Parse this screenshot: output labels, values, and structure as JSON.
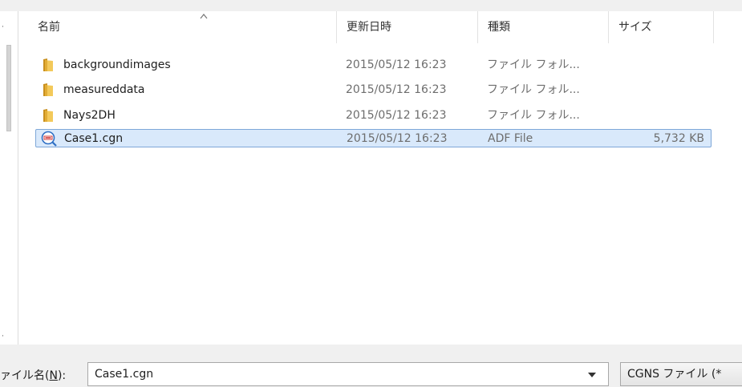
{
  "columns": {
    "name": "名前",
    "date": "更新日時",
    "type": "種類",
    "size": "サイズ"
  },
  "files": [
    {
      "name": "backgroundimages",
      "date": "2015/05/12 16:23",
      "type": "ファイル フォル...",
      "size": "",
      "icon": "folder-icon"
    },
    {
      "name": "measureddata",
      "date": "2015/05/12 16:23",
      "type": "ファイル フォル...",
      "size": "",
      "icon": "folder-icon"
    },
    {
      "name": "Nays2DH",
      "date": "2015/05/12 16:23",
      "type": "ファイル フォル...",
      "size": "",
      "icon": "folder-icon"
    },
    {
      "name": "Case1.cgn",
      "date": "2015/05/12 16:23",
      "type": "ADF File",
      "size": "5,732 KB",
      "icon": "adf-file-icon",
      "selected": true
    }
  ],
  "footer": {
    "filename_label_prefix": "ァイル名(",
    "filename_label_key": "N",
    "filename_label_suffix": "):",
    "filename_value": "Case1.cgn",
    "filetype_value": "CGNS ファイル (*"
  },
  "colors": {
    "selection_bg": "#d9e9fb",
    "selection_border": "#7ea7d8",
    "folder": "#e8b53a"
  }
}
